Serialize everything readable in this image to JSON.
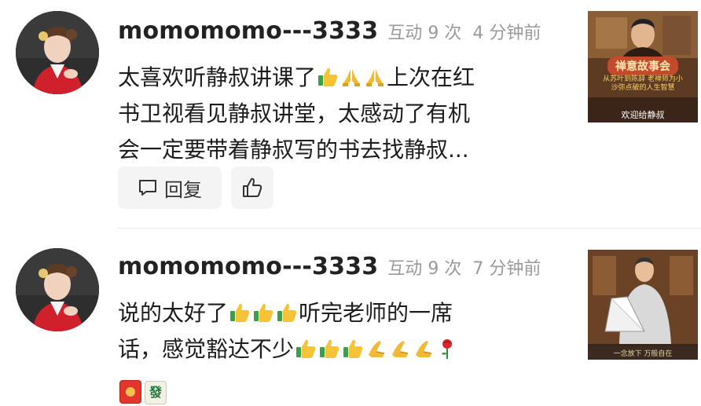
{
  "comments": [
    {
      "username": "momomomo---3333",
      "interactions": "互动 9 次",
      "time": "4 分钟前",
      "lines": [
        [
          "太喜欢听静叔讲课了",
          "上次在红"
        ],
        [
          "书卫视看见静叔讲堂，太感动了有机"
        ],
        [
          "会一定要带着静叔写的书去找静叔..."
        ]
      ],
      "emojis_line1": [
        "thumbs-up",
        "praying-hands",
        "praying-hands"
      ],
      "reply_label": "回复",
      "video_thumb": {
        "title": "禅意故事会",
        "subtitle": "从苏叶到陈辞 老禅师为小沙弥点破的人生智慧",
        "footer": "欢迎给静叔"
      }
    },
    {
      "username": "momomomo---3333",
      "interactions": "互动 9 次",
      "time": "7 分钟前",
      "line1_a": "说的太好了",
      "line1_b": "听完老师的一席",
      "line2_a": "话，感觉豁达不少",
      "emojis_line1": [
        "thumbs-up",
        "thumbs-up",
        "thumbs-up"
      ],
      "emojis_line2": [
        "thumbs-up",
        "thumbs-up",
        "thumbs-up",
        "hands-together",
        "hands-together",
        "hands-together",
        "rose"
      ],
      "line3_tiles": [
        "red-packet",
        "mahjong-fa"
      ],
      "mahjong_char": "發",
      "video_thumb": {
        "bottom_text": "一念放下  万般自在"
      }
    }
  ]
}
